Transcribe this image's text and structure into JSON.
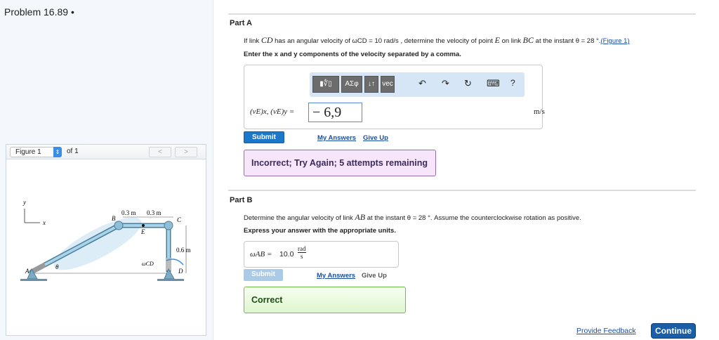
{
  "problem_title": "Problem 16.89 •",
  "figure": {
    "select": "Figure 1",
    "of": "of 1",
    "prev": "<",
    "next": ">",
    "labels": {
      "y": "y",
      "x": "x",
      "A": "A",
      "B": "B",
      "C": "C",
      "D": "D",
      "E": "E",
      "theta": "θ",
      "d1": "0.3 m",
      "d2": "0.3 m",
      "d3": "0.6 m",
      "w": "ωCD"
    }
  },
  "partA": {
    "title": "Part A",
    "q1": "If link",
    "cd": "CD",
    "q2": "has an angular velocity of ωCD = 10 rad/s , determine the velocity of point",
    "e": "E",
    "q3": "on link",
    "bc": "BC",
    "q4": "at the instant θ = 28 °.",
    "fig_link": "(Figure 1)",
    "instr": "Enter the x and y components of the velocity separated by a comma.",
    "toolbar": {
      "templates": "▮∜▯",
      "greek": "ΑΣφ",
      "arrows": "↓↑",
      "vec": "vec",
      "undo": "↶",
      "redo": "↷",
      "reset": "↻",
      "keyboard": "⌨",
      "help": "?"
    },
    "label": "(vE)x, (vE)y =",
    "value": "− 6,9",
    "unit": "m/s",
    "submit": "Submit",
    "my_answers": "My Answers",
    "give_up": "Give Up",
    "feedback": "Incorrect; Try Again; 5 attempts remaining"
  },
  "partB": {
    "title": "Part B",
    "q1": "Determine the angular velocity of link",
    "ab": "AB",
    "q2": "at the instant θ = 28 °. Assume the counterclockwise rotation as positive.",
    "instr": "Express your answer with the appropriate units.",
    "label": "ωAB =",
    "value": "10.0",
    "unit_num": "rad",
    "unit_den": "s",
    "submit": "Submit",
    "my_answers": "My Answers",
    "give_up": "Give Up",
    "feedback": "Correct"
  },
  "footer": {
    "feedback": "Provide Feedback",
    "continue": "Continue"
  }
}
